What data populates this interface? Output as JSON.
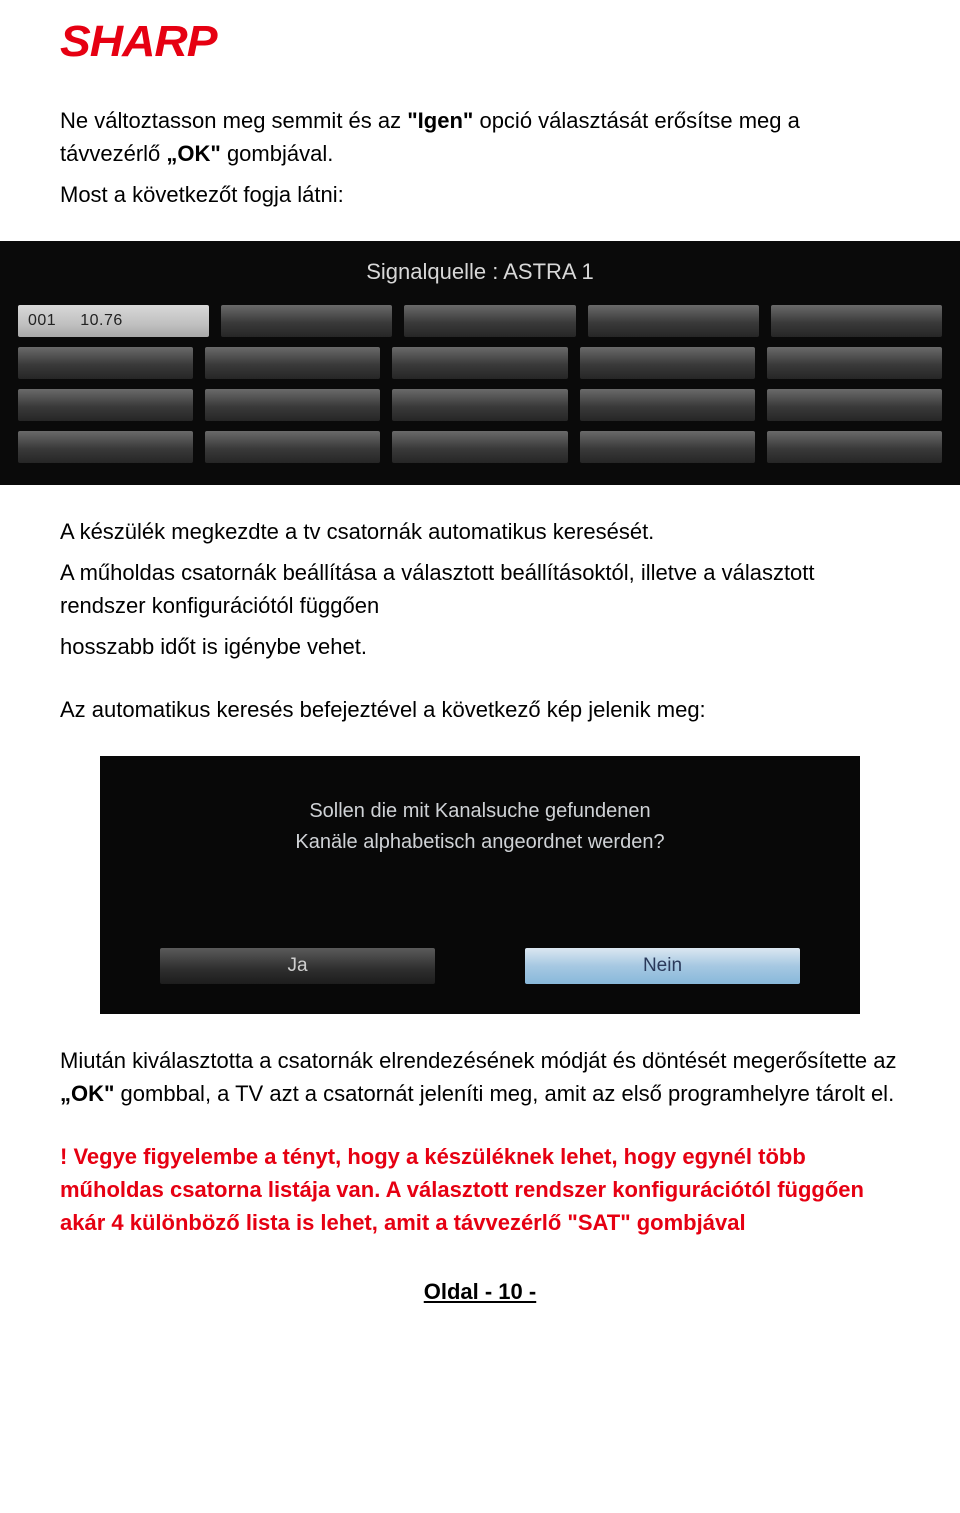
{
  "logo": {
    "brand": "SHARP",
    "color": "#e60012"
  },
  "paragraphs": {
    "p1a": "Ne változtasson meg semmit és az ",
    "p1b": "\"Igen\"",
    "p1c": " opció választását erősítse meg a távvezérlő ",
    "p1d": "„OK\"",
    "p1e": " gombjával.",
    "p2": "Most a következőt fogja látni:",
    "p3": "A készülék megkezdte a tv csatornák automatikus keresését.",
    "p4": "A műholdas csatornák beállítása a választott beállításoktól, illetve a választott rendszer konfigurációtól függően",
    "p5": "hosszabb időt is igénybe vehet.",
    "p6": "Az automatikus keresés befejeztével a következő kép jelenik meg:",
    "p7a": "Miután kiválasztotta a csatornák elrendezésének módját és döntését megerősítette az ",
    "p7b": "„OK\"",
    "p7c": " gombbal, a TV azt a csatornát jeleníti meg, amit az első programhelyre tárolt el."
  },
  "screenshot1": {
    "title": "Signalquelle : ASTRA 1",
    "first_cell_number": "001",
    "first_cell_value": "10.76"
  },
  "screenshot2": {
    "line1": "Sollen die mit Kanalsuche gefundenen",
    "line2": "Kanäle alphabetisch angeordnet werden?",
    "btn_yes": "Ja",
    "btn_no": "Nein"
  },
  "red_note": "! Vegye figyelembe a tényt, hogy a készüléknek lehet, hogy egynél több műholdas csatorna listája van. A választott rendszer konfigurációtól függően akár 4 különböző lista is lehet, amit a távvezérlő \"SAT\" gombjával",
  "page_number": "Oldal - 10 -"
}
